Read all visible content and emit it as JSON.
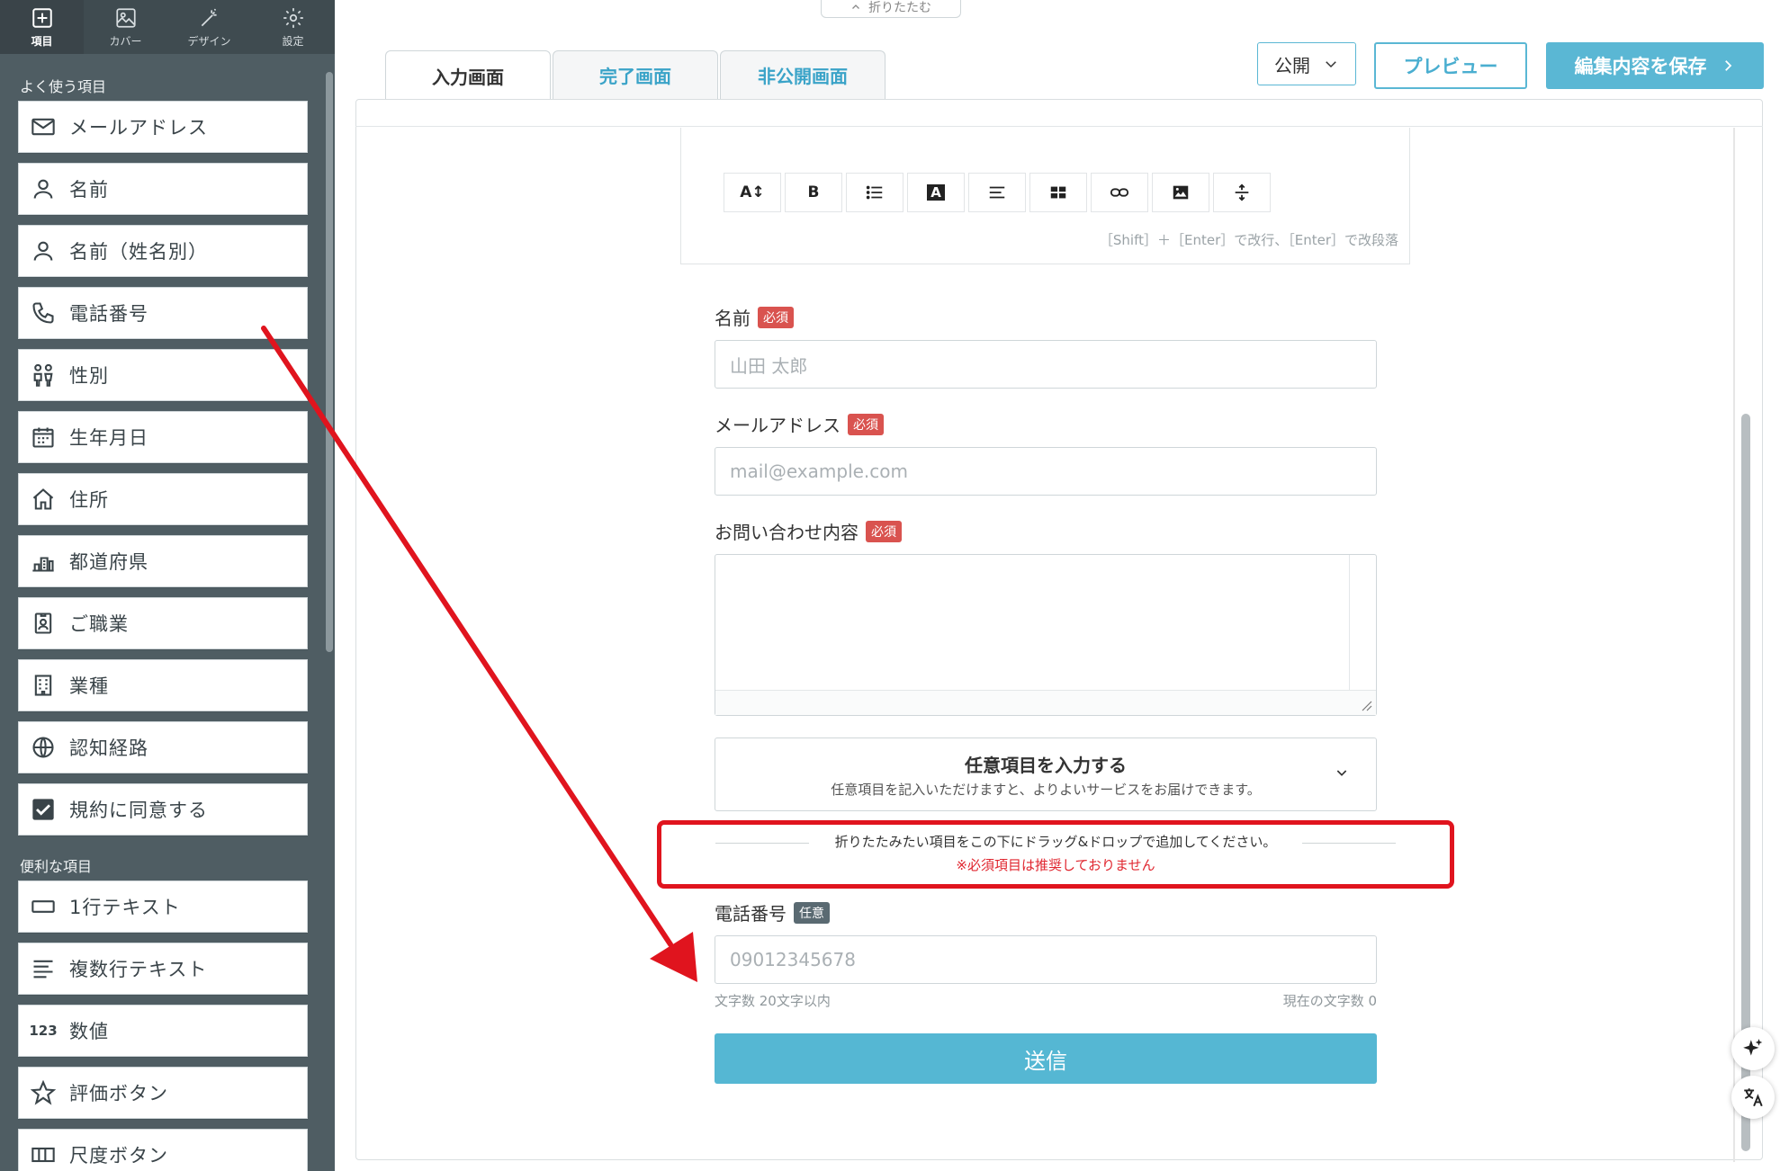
{
  "sidebar": {
    "tabs": [
      {
        "label": "項目",
        "icon": "plus-square-icon"
      },
      {
        "label": "カバー",
        "icon": "image-icon"
      },
      {
        "label": "デザイン",
        "icon": "magic-wand-icon"
      },
      {
        "label": "設定",
        "icon": "gear-icon"
      }
    ],
    "section1_title": "よく使う項目",
    "section1_items": [
      {
        "label": "メールアドレス",
        "icon": "mail-icon"
      },
      {
        "label": "名前",
        "icon": "person-icon"
      },
      {
        "label": "名前（姓名別）",
        "icon": "person-icon"
      },
      {
        "label": "電話番号",
        "icon": "phone-icon"
      },
      {
        "label": "性別",
        "icon": "gender-icon"
      },
      {
        "label": "生年月日",
        "icon": "calendar-icon"
      },
      {
        "label": "住所",
        "icon": "home-icon"
      },
      {
        "label": "都道府県",
        "icon": "city-icon"
      },
      {
        "label": "ご職業",
        "icon": "id-badge-icon"
      },
      {
        "label": "業種",
        "icon": "building-icon"
      },
      {
        "label": "認知経路",
        "icon": "globe-icon"
      },
      {
        "label": "規約に同意する",
        "icon": "checkbox-icon"
      }
    ],
    "section2_title": "便利な項目",
    "section2_items": [
      {
        "label": "1行テキスト",
        "icon": "single-line-icon"
      },
      {
        "label": "複数行テキスト",
        "icon": "multi-line-icon"
      },
      {
        "label": "数値",
        "icon": "number-icon",
        "glyph": "123"
      },
      {
        "label": "評価ボタン",
        "icon": "star-icon"
      },
      {
        "label": "尺度ボタン",
        "icon": "scale-icon"
      }
    ]
  },
  "top": {
    "collapse_label": "折りたたむ",
    "tabs": [
      "入力画面",
      "完了画面",
      "非公開画面"
    ],
    "public_label": "公開",
    "preview_label": "プレビュー",
    "save_label": "編集内容を保存"
  },
  "editor": {
    "toolbar_icons": [
      "font-size-icon",
      "bold-icon",
      "list-icon",
      "text-color-icon",
      "align-icon",
      "table-icon",
      "link-icon",
      "image-icon",
      "spacing-icon"
    ],
    "font_size_glyph": "A↕",
    "bold_glyph": "B",
    "text_color_glyph": "A",
    "hint": "［Shift］＋［Enter］で改行、［Enter］で改段落"
  },
  "form": {
    "name_label": "名前",
    "name_placeholder": "山田 太郎",
    "email_label": "メールアドレス",
    "email_placeholder": "mail@example.com",
    "inquiry_label": "お問い合わせ内容",
    "required_badge": "必須",
    "optional_badge": "任意",
    "optional_title": "任意項目を入力する",
    "optional_desc": "任意項目を記入いただけますと、よりよいサービスをお届けできます。",
    "drop_text": "折りたたみたい項目をこの下にドラッグ&ドロップで追加してください。",
    "drop_note": "※必須項目は推奨しておりません",
    "phone_label": "電話番号",
    "phone_placeholder": "09012345678",
    "char_limit": "文字数 20文字以内",
    "char_count": "現在の文字数 0",
    "submit_label": "送信"
  },
  "colors": {
    "accent": "#55b7d3",
    "sidebar_bg": "#4f5d63",
    "required": "#d9534f",
    "highlight": "#e0141e"
  }
}
